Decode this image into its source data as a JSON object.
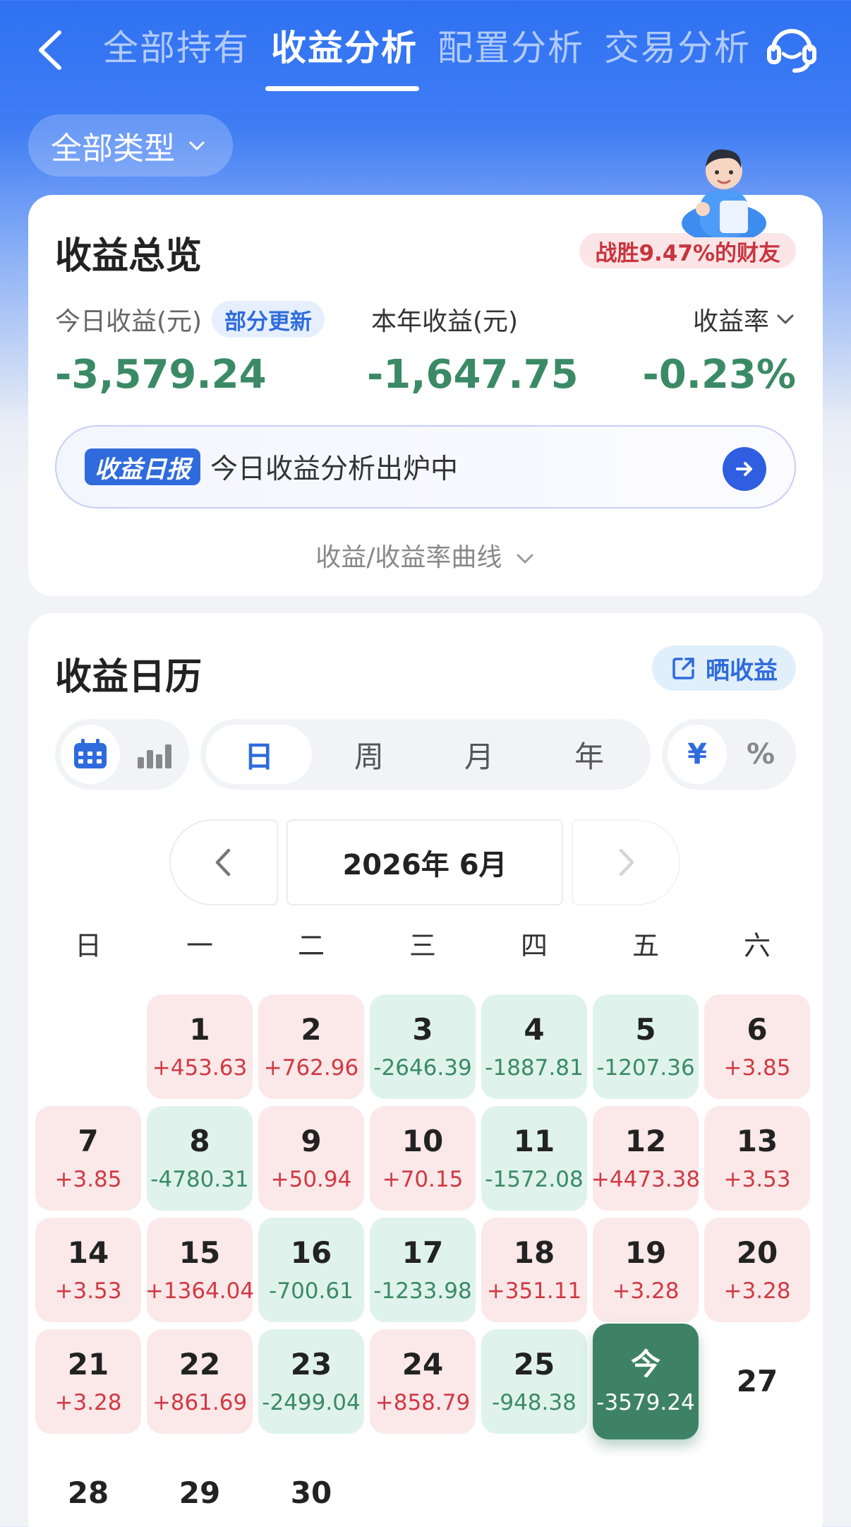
{
  "nav": {
    "tabs": [
      {
        "label": "全部持有"
      },
      {
        "label": "收益分析"
      },
      {
        "label": "配置分析"
      },
      {
        "label": "交易分析"
      }
    ],
    "active_tab": 1
  },
  "filter": {
    "type_label": "全部类型"
  },
  "overview": {
    "title": "收益总览",
    "beat_badge": "战胜9.47%的财友",
    "today_label": "今日收益(元)",
    "partial_badge": "部分更新",
    "today_value": "-3,579.24",
    "year_label": "本年收益(元)",
    "year_value": "-1,647.75",
    "rate_label": "收益率",
    "rate_value": "-0.23%",
    "report_tag": "收益日报",
    "report_text": "今日收益分析出炉中",
    "curve_toggle": "收益/收益率曲线"
  },
  "calendar": {
    "title": "收益日历",
    "share_label": "晒收益",
    "periods": [
      "日",
      "周",
      "月",
      "年"
    ],
    "active_period": "日",
    "units": [
      "¥",
      "%"
    ],
    "active_unit": "¥",
    "month_label": "2026年 6月",
    "weekdays": [
      "日",
      "一",
      "二",
      "三",
      "四",
      "五",
      "六"
    ],
    "days": [
      {
        "n": "1",
        "v": "+453.63",
        "s": "gain"
      },
      {
        "n": "2",
        "v": "+762.96",
        "s": "gain"
      },
      {
        "n": "3",
        "v": "-2646.39",
        "s": "loss"
      },
      {
        "n": "4",
        "v": "-1887.81",
        "s": "loss"
      },
      {
        "n": "5",
        "v": "-1207.36",
        "s": "loss"
      },
      {
        "n": "6",
        "v": "+3.85",
        "s": "gain"
      },
      {
        "n": "7",
        "v": "+3.85",
        "s": "gain"
      },
      {
        "n": "8",
        "v": "-4780.31",
        "s": "loss"
      },
      {
        "n": "9",
        "v": "+50.94",
        "s": "gain"
      },
      {
        "n": "10",
        "v": "+70.15",
        "s": "gain"
      },
      {
        "n": "11",
        "v": "-1572.08",
        "s": "loss"
      },
      {
        "n": "12",
        "v": "+4473.38",
        "s": "gain"
      },
      {
        "n": "13",
        "v": "+3.53",
        "s": "gain"
      },
      {
        "n": "14",
        "v": "+3.53",
        "s": "gain"
      },
      {
        "n": "15",
        "v": "+1364.04",
        "s": "gain"
      },
      {
        "n": "16",
        "v": "-700.61",
        "s": "loss"
      },
      {
        "n": "17",
        "v": "-1233.98",
        "s": "loss"
      },
      {
        "n": "18",
        "v": "+351.11",
        "s": "gain"
      },
      {
        "n": "19",
        "v": "+3.28",
        "s": "gain"
      },
      {
        "n": "20",
        "v": "+3.28",
        "s": "gain"
      },
      {
        "n": "21",
        "v": "+3.28",
        "s": "gain"
      },
      {
        "n": "22",
        "v": "+861.69",
        "s": "gain"
      },
      {
        "n": "23",
        "v": "-2499.04",
        "s": "loss"
      },
      {
        "n": "24",
        "v": "+858.79",
        "s": "gain"
      },
      {
        "n": "25",
        "v": "-948.38",
        "s": "loss"
      },
      {
        "n": "今",
        "v": "-3579.24",
        "s": "today"
      },
      {
        "n": "27",
        "v": "",
        "s": "none"
      },
      {
        "n": "28",
        "v": "",
        "s": "none"
      },
      {
        "n": "29",
        "v": "",
        "s": "none"
      },
      {
        "n": "30",
        "v": "",
        "s": "none"
      }
    ],
    "first_weekday": 1
  },
  "colors": {
    "brand_blue": "#2f71f2",
    "gain_red": "#cf3a44",
    "loss_green": "#3b8a66",
    "today_green": "#3e8266"
  }
}
